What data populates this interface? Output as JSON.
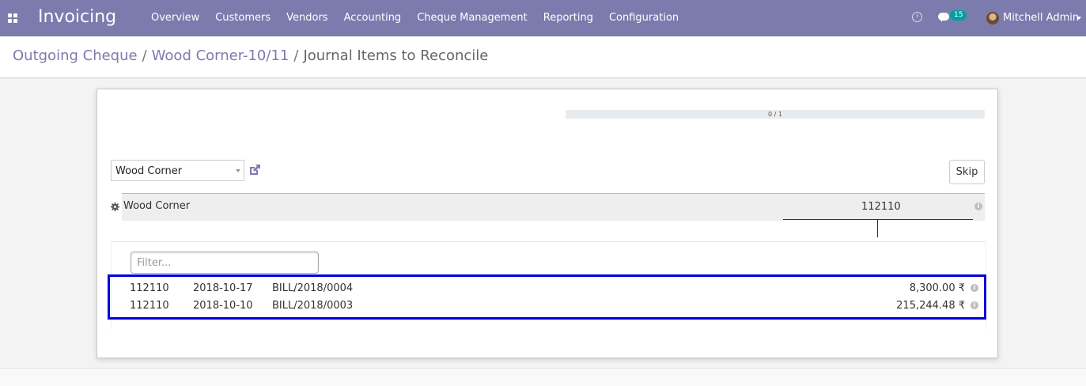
{
  "app": {
    "title": "Invoicing",
    "menu": [
      "Overview",
      "Customers",
      "Vendors",
      "Accounting",
      "Cheque Management",
      "Reporting",
      "Configuration"
    ],
    "notification_count": "15",
    "user_name": "Mitchell Admin",
    "accent_color": "#7c7bad"
  },
  "breadcrumb": {
    "items": [
      "Outgoing Cheque",
      "Wood Corner-10/11"
    ],
    "separator": "/",
    "current": "Journal Items to Reconcile"
  },
  "reconcile": {
    "progress_text": "0 / 1",
    "progress_fraction": 0,
    "partner_select_value": "Wood Corner",
    "skip_label": "Skip",
    "line_partner": "Wood Corner",
    "line_account": "112110",
    "filter_placeholder": "Filter...",
    "rows": [
      {
        "account": "112110",
        "date": "2018-10-17",
        "ref": "BILL/2018/0004",
        "amount": "8,300.00 ₹"
      },
      {
        "account": "112110",
        "date": "2018-10-10",
        "ref": "BILL/2018/0003",
        "amount": "215,244.48 ₹"
      }
    ]
  }
}
